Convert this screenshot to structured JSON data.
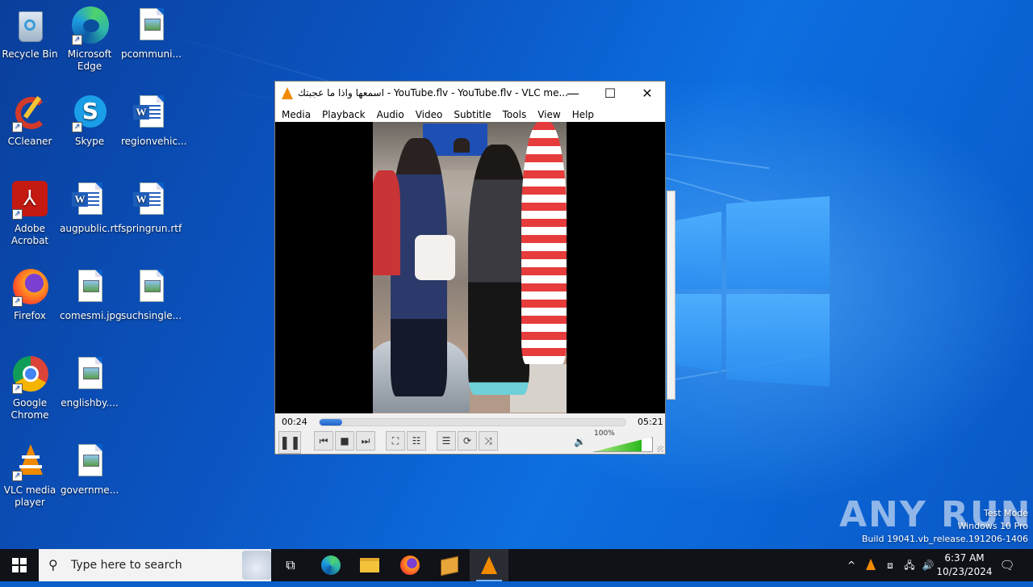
{
  "desktop": {
    "icons": [
      {
        "label": "Recycle Bin"
      },
      {
        "label": "Microsoft Edge"
      },
      {
        "label": "pcommuni..."
      },
      {
        "label": "CCleaner"
      },
      {
        "label": "Skype"
      },
      {
        "label": "regionvehic..."
      },
      {
        "label": "Adobe Acrobat"
      },
      {
        "label": "augpublic.rtf"
      },
      {
        "label": "springrun.rtf"
      },
      {
        "label": "Firefox"
      },
      {
        "label": "comesmi.jpg"
      },
      {
        "label": "suchsingle..."
      },
      {
        "label": "Google Chrome"
      },
      {
        "label": "englishby...."
      },
      {
        "label": "VLC media player"
      },
      {
        "label": "governme..."
      }
    ]
  },
  "vlc": {
    "title": "اسمعها واذا ما عجبتك - YouTube.flv - YouTube.flv - VLC me...",
    "menu": [
      "Media",
      "Playback",
      "Audio",
      "Video",
      "Subtitle",
      "Tools",
      "View",
      "Help"
    ],
    "elapsed": "00:24",
    "total": "05:21",
    "progress_fraction": 0.075,
    "volume_label": "100%",
    "volume_fraction": 0.82,
    "window_buttons": {
      "minimize": "—",
      "maximize": "☐",
      "close": "✕"
    }
  },
  "watermark": {
    "brand": "ANY RUN",
    "line1": "Test Mode",
    "line2": "Windows 10 Pro",
    "line3": "Build 19041.vb_release.191206-1406"
  },
  "taskbar": {
    "search_placeholder": "Type here to search",
    "time": "6:37 AM",
    "date": "10/23/2024"
  }
}
